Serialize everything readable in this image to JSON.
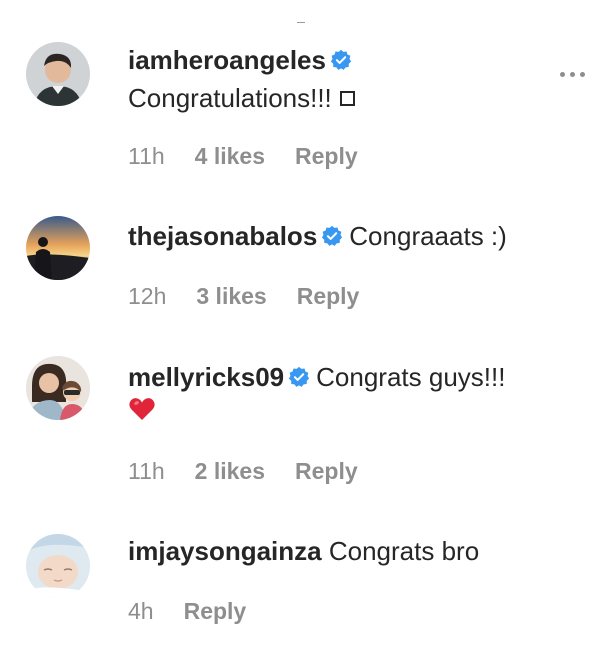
{
  "comments": [
    {
      "username": "iamheroangeles",
      "verified": true,
      "text": "Congratulations!!!",
      "trailing_glyph": "square-glyph",
      "time": "11h",
      "likes": "4 likes",
      "reply": "Reply",
      "avatar_icon": "avatar-man-portrait"
    },
    {
      "username": "thejasonabalos",
      "verified": true,
      "text": "Congraaats :)",
      "time": "12h",
      "likes": "3 likes",
      "reply": "Reply",
      "avatar_icon": "avatar-sunset-silhouette"
    },
    {
      "username": "mellyricks09",
      "verified": true,
      "text": "Congrats guys!!!",
      "second_line_icon": "red-heart-emoji",
      "time": "11h",
      "likes": "2 likes",
      "reply": "Reply",
      "avatar_icon": "avatar-woman-with-child"
    },
    {
      "username": "imjaysongainza",
      "verified": false,
      "text": "Congrats bro",
      "time": "4h",
      "reply": "Reply",
      "avatar_icon": "avatar-baby"
    }
  ],
  "colors": {
    "text": "#262626",
    "meta": "#8e8e8e",
    "verified_badge": "#3897f0",
    "heart": "#e0243a"
  },
  "icons": {
    "more_options": "more-options-icon",
    "verified": "verified-badge-icon"
  }
}
